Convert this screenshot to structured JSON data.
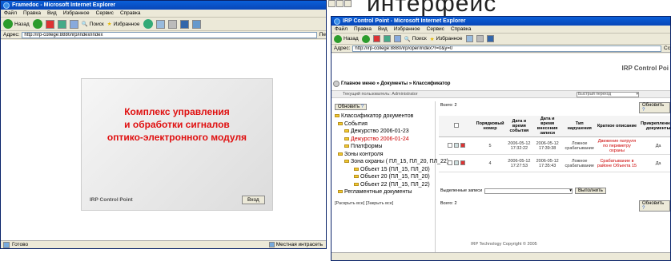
{
  "left": {
    "title": "Framedoc - Microsoft Internet Explorer",
    "menu": [
      "Файл",
      "Правка",
      "Вид",
      "Избранное",
      "Сервис",
      "Справка"
    ],
    "back": "Назад",
    "search": "Поиск",
    "favorites": "Избранное",
    "addr_label": "Адрес:",
    "addr_value": "http://irp-college:8880/irp/index/index",
    "addr_go": "Пе",
    "banner": [
      "Комплекс управления",
      "и обработки сигналов",
      "оптико-электронного модуля"
    ],
    "brand": "IRP Control Point",
    "login": "Вход",
    "status": "Готово",
    "zone": "Местная интрасеть"
  },
  "bg_heading": "интерфейс",
  "right": {
    "title": "IRP Control Point - Microsoft Internet Explorer",
    "menu": [
      "Файл",
      "Правка",
      "Вид",
      "Избранное",
      "Сервис",
      "Справка"
    ],
    "back": "Назад",
    "search": "Поиск",
    "favorites": "Избранное",
    "addr_label": "Адрес:",
    "addr_value": "http://irp-college:8880/irp/oper/index?r=0&y=0",
    "addr_go": "Сс",
    "brand": "IRP Control Poi",
    "breadcrumb": "Главное меню » Документы » Классификатор",
    "user": "Текущий пользователь: Administrator",
    "quick": "Быстрый переход",
    "refresh": "Обновить",
    "total": "Всего: 2",
    "total_bottom": "Всего: 2",
    "tree": [
      "Классификатор документов",
      "События",
      "Дежурство 2006-01-23",
      "Дежурство 2006-01-24",
      "Платформы",
      "Зоны контроля",
      "Зона охраны ( ПЛ_15, ПЛ_20, ПЛ_22)",
      "Объект 15 (ПЛ_15, ПЛ_20)",
      "Объект 20 (ПЛ_15, ПЛ_20)",
      "Объект 22 (ПЛ_15, ПЛ_22)",
      "Регламентные документы"
    ],
    "expand": "[Раскрыть все] [Закрыть все]",
    "columns": [
      "Порядковый номер",
      "Дата и время события",
      "Дата и время внесения записи",
      "Тип нарушения",
      "Краткое описание",
      "Прикрепленные документы"
    ],
    "rows": [
      [
        "5",
        "2006-05-12 17:32:22",
        "2006-05-12 17:39:38",
        "Ложное срабатывание",
        "Движение патруля по периметру охраны",
        "Да"
      ],
      [
        "4",
        "2006-05-12 17:27:53",
        "2006-05-12 17:35:43",
        "Ложное срабатывание",
        "Срабатывание в районе Объекта 15",
        "Да"
      ]
    ],
    "selected_label": "Выделенные записи",
    "execute": "Выполнить",
    "copyright": "IRP Technology Copyright © 2005"
  }
}
